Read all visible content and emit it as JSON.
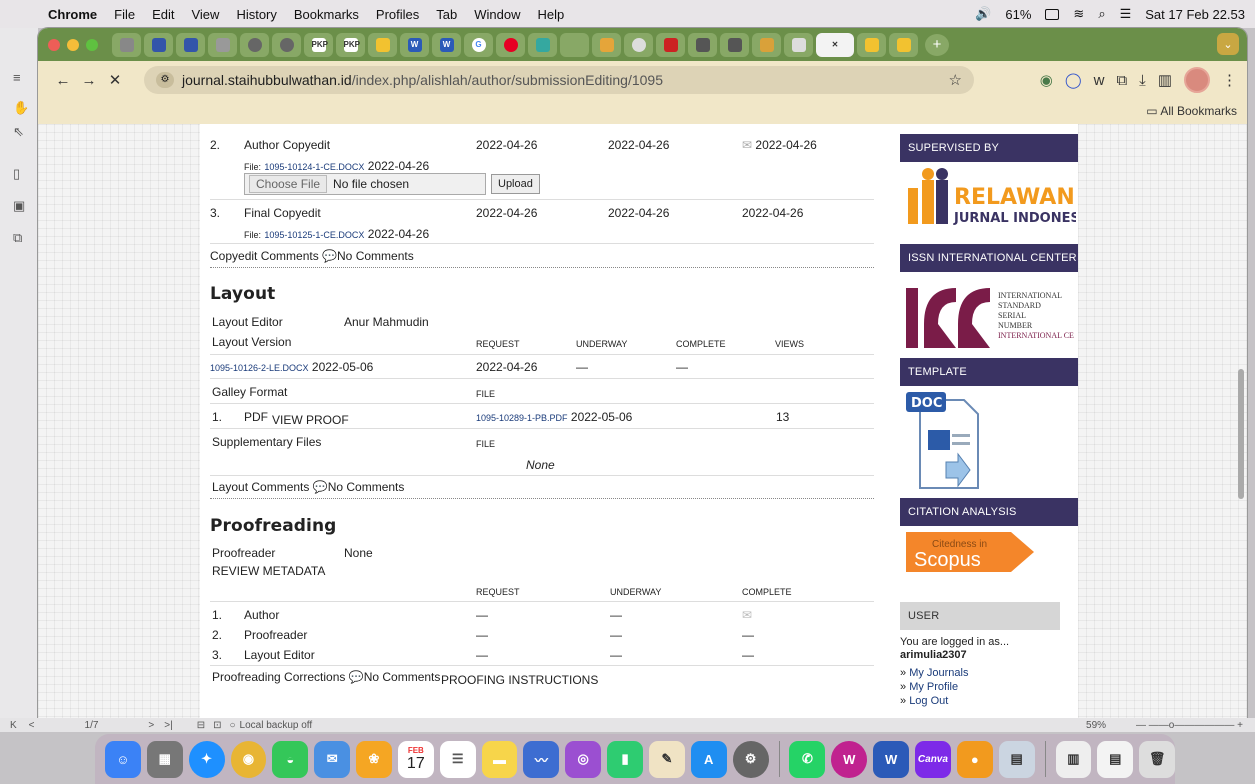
{
  "menubar": {
    "app": "Chrome",
    "items": [
      "File",
      "Edit",
      "View",
      "History",
      "Bookmarks",
      "Profiles",
      "Tab",
      "Window",
      "Help"
    ],
    "battery": "61%",
    "datetime": "Sat 17 Feb 22.53"
  },
  "browser": {
    "url_host": "journal.staihubbulwathan.id",
    "url_path": "/index.php/alishlah/author/submissionEditing/1095",
    "all_bookmarks": "All Bookmarks",
    "tab_labels": [
      "PKP",
      "PKP",
      "W",
      "W"
    ]
  },
  "copyedit": {
    "rows": [
      {
        "num": "2.",
        "label": "Author Copyedit",
        "request": "2022-04-26",
        "underway": "2022-04-26",
        "complete": "2022-04-26",
        "file_label": "File:",
        "file": "1095-10124-1-CE.DOCX",
        "file_date": "2022-04-26"
      },
      {
        "num": "3.",
        "label": "Final Copyedit",
        "request": "2022-04-26",
        "underway": "2022-04-26",
        "complete": "2022-04-26",
        "file_label": "File:",
        "file": "1095-10125-1-CE.DOCX",
        "file_date": "2022-04-26"
      }
    ],
    "choose_file": "Choose File",
    "no_file": "No file chosen",
    "upload": "Upload",
    "comments_label": "Copyedit Comments",
    "comments_value": "No Comments"
  },
  "layout": {
    "title": "Layout",
    "editor_label": "Layout Editor",
    "editor_name": "Anur Mahmudin",
    "version_label": "Layout Version",
    "col_request": "REQUEST",
    "col_underway": "UNDERWAY",
    "col_complete": "COMPLETE",
    "col_views": "VIEWS",
    "version_file": "1095-10126-2-LE.DOCX",
    "version_date": "2022-05-06",
    "version_request": "2022-04-26",
    "version_underway": "—",
    "version_complete": "—",
    "galley_label": "Galley Format",
    "col_file": "FILE",
    "galley_num": "1.",
    "galley_type": "PDF",
    "view_proof": "VIEW PROOF",
    "galley_file": "1095-10289-1-PB.PDF",
    "galley_date": "2022-05-06",
    "galley_views": "13",
    "supp_label": "Supplementary Files",
    "supp_col_file": "FILE",
    "supp_none": "None",
    "comments_label": "Layout Comments",
    "comments_value": "No Comments"
  },
  "proofreading": {
    "title": "Proofreading",
    "proofreader_label": "Proofreader",
    "proofreader_name": "None",
    "review_metadata": "REVIEW METADATA",
    "col_request": "REQUEST",
    "col_underway": "UNDERWAY",
    "col_complete": "COMPLETE",
    "rows": [
      {
        "num": "1.",
        "label": "Author",
        "request": "—",
        "underway": "—",
        "complete": ""
      },
      {
        "num": "2.",
        "label": "Proofreader",
        "request": "—",
        "underway": "—",
        "complete": "—"
      },
      {
        "num": "3.",
        "label": "Layout Editor",
        "request": "—",
        "underway": "—",
        "complete": "—"
      }
    ],
    "corrections_label": "Proofreading Corrections",
    "corrections_value": "No Comments",
    "instructions": "PROOFING INSTRUCTIONS"
  },
  "sidebar": {
    "supervised_by": "SUPERVISED BY",
    "relawan_top": "RELAWAN",
    "relawan_bottom": "JURNAL INDONESIA",
    "issn_center": "ISSN INTERNATIONAL CENTER",
    "issn_lines": [
      "INTERNATIONAL",
      "STANDARD",
      "SERIAL",
      "NUMBER",
      "INTERNATIONAL CE"
    ],
    "template": "TEMPLATE",
    "doc": "DOC",
    "citation": "CITATION ANALYSIS",
    "scopus_small": "Citedness in",
    "scopus_big": "Scopus",
    "user": "USER",
    "logged_in": "You are logged in as...",
    "username": "arimulia2307",
    "links": [
      "My Journals",
      "My Profile",
      "Log Out"
    ]
  },
  "pdfbar": {
    "page": "1/7",
    "backup": "Local backup off",
    "zoom": "59%"
  },
  "dock": {
    "calendar_month": "FEB",
    "calendar_day": "17",
    "canva": "Canva"
  }
}
